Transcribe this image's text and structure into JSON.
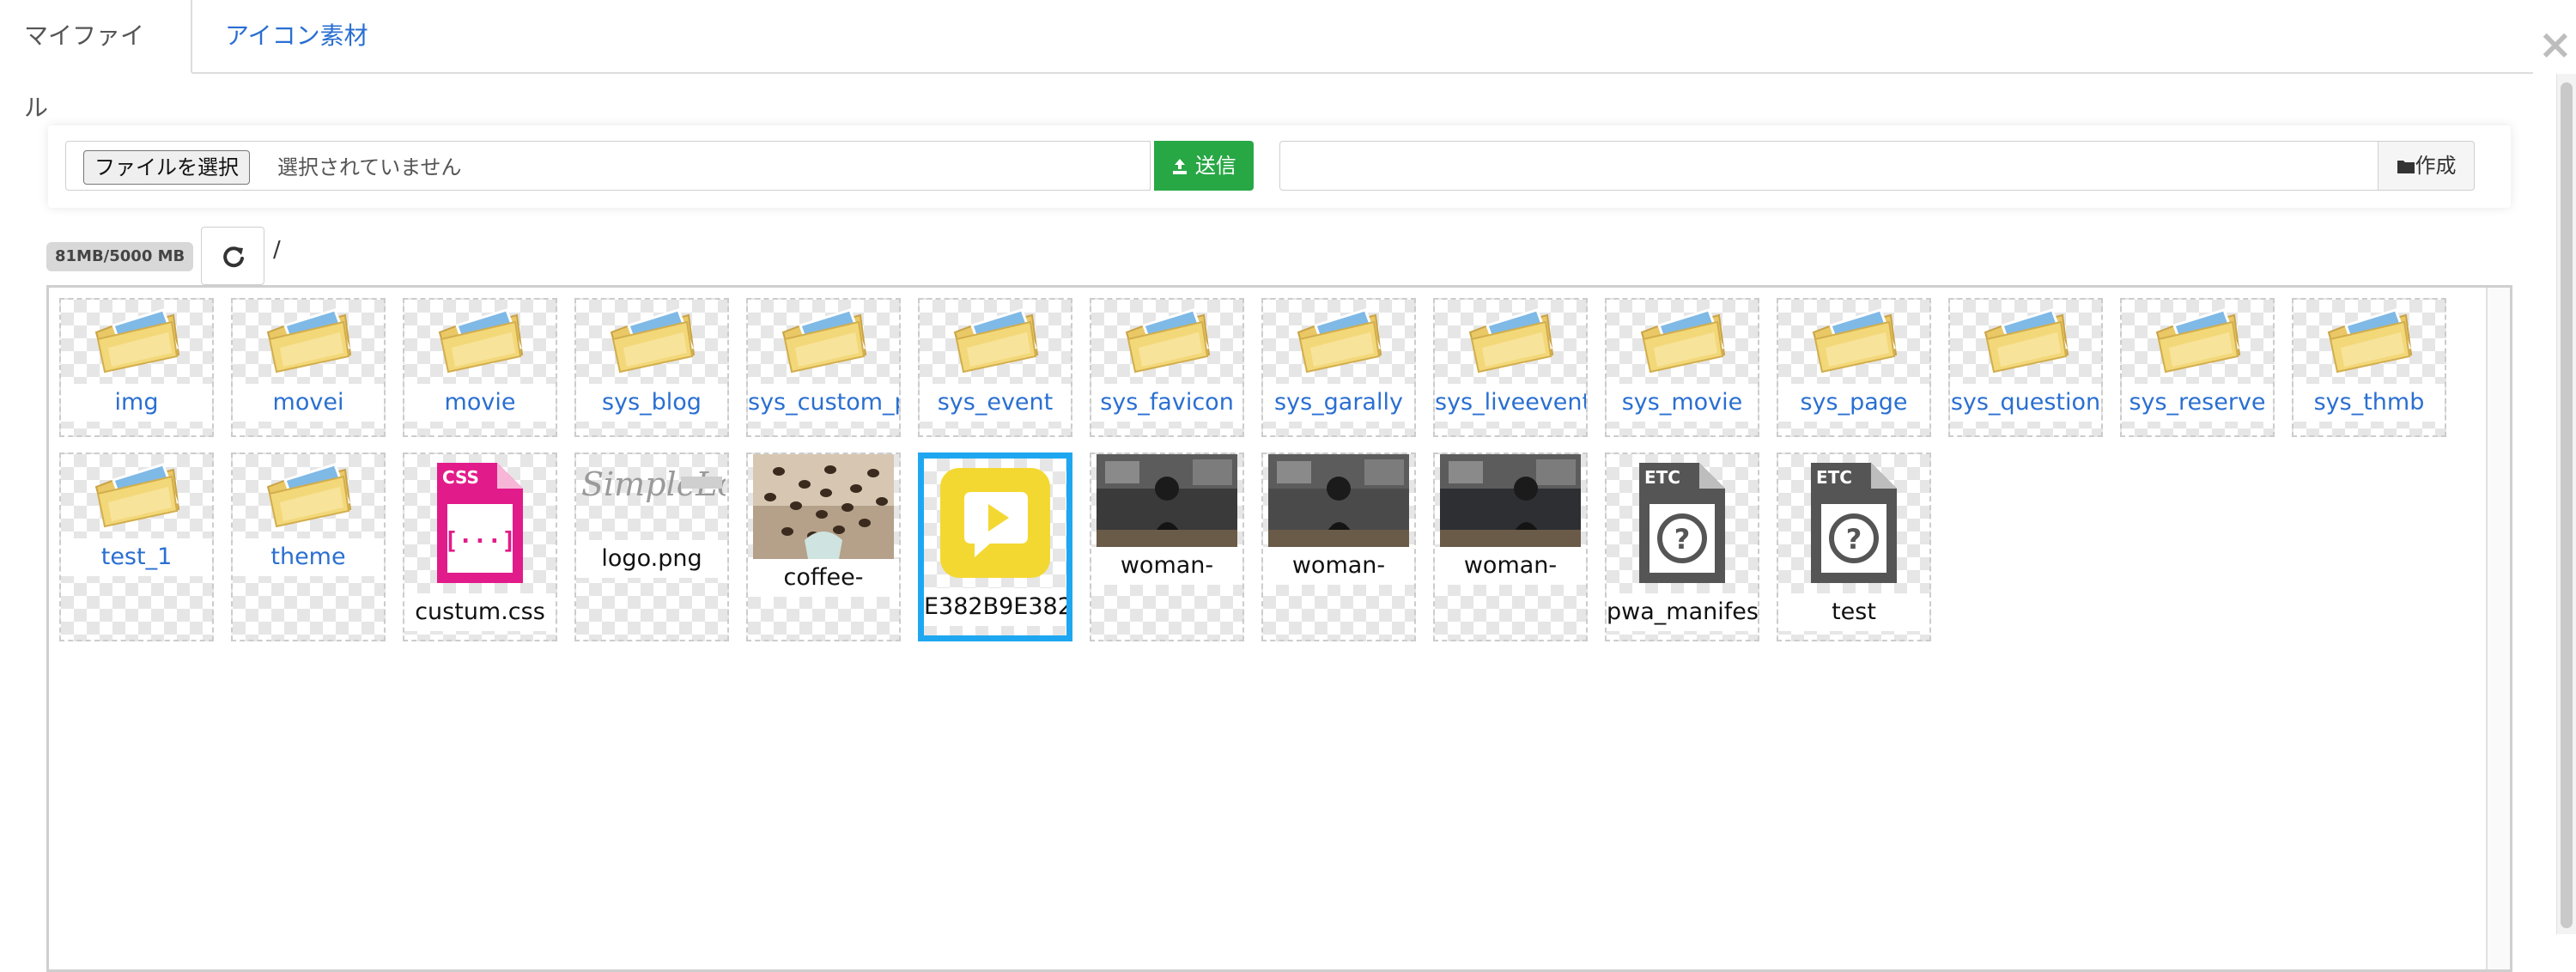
{
  "tabs": [
    {
      "label": "マイファイル",
      "active": true
    },
    {
      "label": "アイコン素材",
      "active": false
    }
  ],
  "upload": {
    "choose_file_label": "ファイルを選択",
    "no_file_selected": "選択されていません",
    "send_label": "送信",
    "folder_name_value": "",
    "create_label": "作成"
  },
  "storage": {
    "usage_badge": "81MB/5000 MB",
    "current_path": "/"
  },
  "colors": {
    "accent_link": "#2a6fd1",
    "send_green": "#28a745",
    "selected_border": "#1ea7f0",
    "css_icon_pink": "#e21b8a",
    "logo_yellow": "#f4d832"
  },
  "files": [
    {
      "name": "img",
      "kind": "folder",
      "icon": "folder-icon"
    },
    {
      "name": "movei",
      "kind": "folder",
      "icon": "folder-icon"
    },
    {
      "name": "movie",
      "kind": "folder",
      "icon": "folder-icon"
    },
    {
      "name": "sys_blog",
      "kind": "folder",
      "icon": "folder-icon"
    },
    {
      "name": "sys_custom_p",
      "kind": "folder",
      "icon": "folder-icon"
    },
    {
      "name": "sys_event",
      "kind": "folder",
      "icon": "folder-icon"
    },
    {
      "name": "sys_favicon",
      "kind": "folder",
      "icon": "folder-icon"
    },
    {
      "name": "sys_garally",
      "kind": "folder",
      "icon": "folder-icon"
    },
    {
      "name": "sys_liveevent",
      "kind": "folder",
      "icon": "folder-icon"
    },
    {
      "name": "sys_movie",
      "kind": "folder",
      "icon": "folder-icon"
    },
    {
      "name": "sys_page",
      "kind": "folder",
      "icon": "folder-icon"
    },
    {
      "name": "sys_question",
      "kind": "folder",
      "icon": "folder-icon"
    },
    {
      "name": "sys_reserve",
      "kind": "folder",
      "icon": "folder-icon"
    },
    {
      "name": "sys_thmb",
      "kind": "folder",
      "icon": "folder-icon"
    },
    {
      "name": "test_1",
      "kind": "folder",
      "icon": "folder-icon"
    },
    {
      "name": "theme",
      "kind": "folder",
      "icon": "folder-icon"
    },
    {
      "name": "custum.css",
      "kind": "css",
      "icon": "css-file-icon",
      "icon_text": "CSS"
    },
    {
      "name": "logo.png",
      "kind": "image",
      "icon": "logo-thumbnail"
    },
    {
      "name": "coffee-",
      "kind": "image",
      "icon": "coffee-thumbnail"
    },
    {
      "name": "E382B9E382",
      "kind": "image",
      "icon": "play-logo-thumbnail",
      "selected": true
    },
    {
      "name": "woman-",
      "kind": "image",
      "icon": "woman-photo-thumbnail"
    },
    {
      "name": "woman-",
      "kind": "image",
      "icon": "woman-photo-thumbnail"
    },
    {
      "name": "woman-",
      "kind": "image",
      "icon": "woman-photo-thumbnail"
    },
    {
      "name": "pwa_manifest",
      "kind": "etc",
      "icon": "etc-file-icon",
      "icon_text": "ETC"
    },
    {
      "name": "test",
      "kind": "etc",
      "icon": "etc-file-icon",
      "icon_text": "ETC"
    }
  ]
}
